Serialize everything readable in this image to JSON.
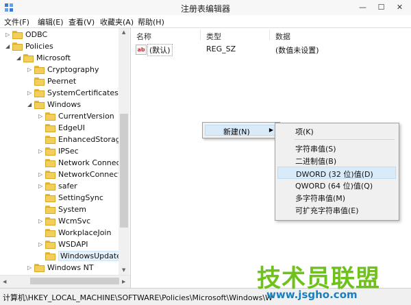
{
  "window": {
    "title": "注册表编辑器",
    "minimize_glyph": "—",
    "maximize_glyph": "☐",
    "close_glyph": "✕"
  },
  "menu": [
    "文件(F)",
    "编辑(E)",
    "查看(V)",
    "收藏夹(A)",
    "帮助(H)"
  ],
  "tree": [
    {
      "label": "ODBC",
      "level": 0,
      "arrow": "▷"
    },
    {
      "label": "Policies",
      "level": 0,
      "arrow": "◢"
    },
    {
      "label": "Microsoft",
      "level": 1,
      "arrow": "◢"
    },
    {
      "label": "Cryptography",
      "level": 2,
      "arrow": "▷"
    },
    {
      "label": "Peernet",
      "level": 2,
      "arrow": ""
    },
    {
      "label": "SystemCertificates",
      "level": 2,
      "arrow": "▷"
    },
    {
      "label": "Windows",
      "level": 2,
      "arrow": "◢"
    },
    {
      "label": "CurrentVersion",
      "level": 3,
      "arrow": "▷"
    },
    {
      "label": "EdgeUI",
      "level": 3,
      "arrow": ""
    },
    {
      "label": "EnhancedStorage",
      "level": 3,
      "arrow": ""
    },
    {
      "label": "IPSec",
      "level": 3,
      "arrow": "▷"
    },
    {
      "label": "Network Connect",
      "level": 3,
      "arrow": ""
    },
    {
      "label": "NetworkConnecti",
      "level": 3,
      "arrow": "▷"
    },
    {
      "label": "safer",
      "level": 3,
      "arrow": "▷"
    },
    {
      "label": "SettingSync",
      "level": 3,
      "arrow": ""
    },
    {
      "label": "System",
      "level": 3,
      "arrow": ""
    },
    {
      "label": "WcmSvc",
      "level": 3,
      "arrow": "▷"
    },
    {
      "label": "WorkplaceJoin",
      "level": 3,
      "arrow": ""
    },
    {
      "label": "WSDAPI",
      "level": 3,
      "arrow": "▷"
    },
    {
      "label": "WindowsUpdate",
      "level": 3,
      "arrow": "",
      "selected": true
    },
    {
      "label": "Windows NT",
      "level": 2,
      "arrow": "▷"
    }
  ],
  "list": {
    "columns": [
      "名称",
      "类型",
      "数据"
    ],
    "rows": [
      {
        "icon": "ab",
        "name": "(默认)",
        "type": "REG_SZ",
        "data": "(数值未设置)"
      }
    ]
  },
  "context_menu": {
    "item": "新建(N)",
    "arrow": "▶"
  },
  "submenu": {
    "key": "项(K)",
    "values": [
      "字符串值(S)",
      "二进制值(B)",
      "DWORD (32 位)值(D)",
      "QWORD (64 位)值(Q)",
      "多字符串值(M)",
      "可扩充字符串值(E)"
    ],
    "highlighted_index": 2
  },
  "status": "计算机\\HKEY_LOCAL_MACHINE\\SOFTWARE\\Policies\\Microsoft\\Windows\\W",
  "watermark": {
    "title": "技术员联盟",
    "url": "www.jsgho.com"
  },
  "colors": {
    "highlight": "#d9ebf9",
    "folder": "#f2cf5b",
    "watermark_green": "#6fc21b",
    "watermark_blue": "#1a7fbf"
  }
}
